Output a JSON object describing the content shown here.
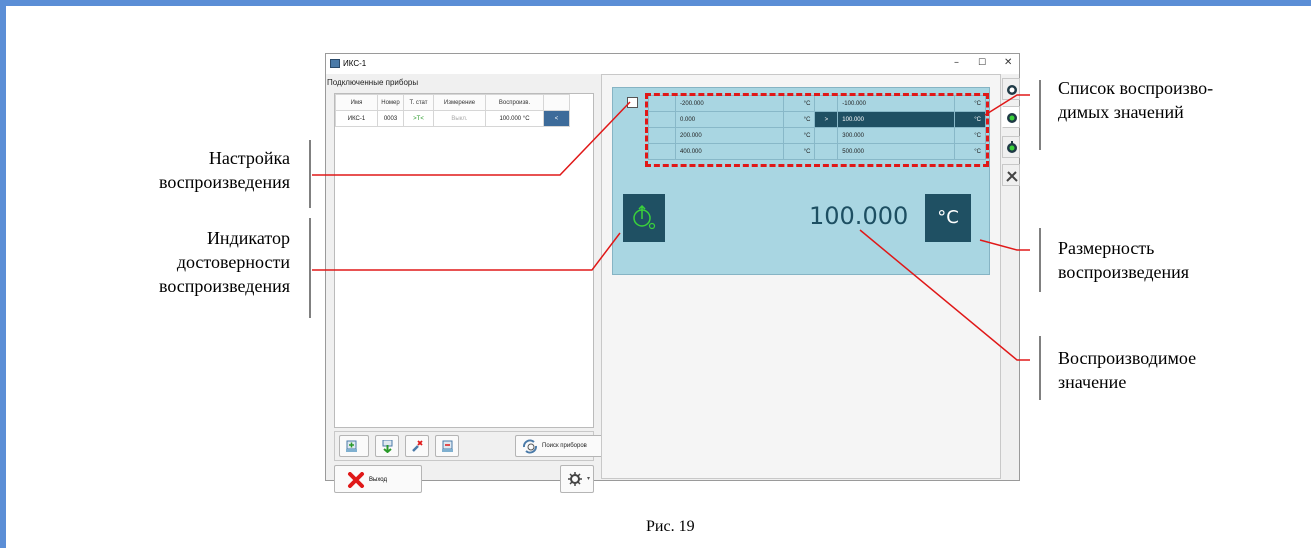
{
  "window": {
    "title": "ИКС-1",
    "minimize": "–",
    "maximize": "☐",
    "close": "✕"
  },
  "left_panel": {
    "section_title": "Подключенные приборы",
    "table": {
      "headers": [
        "Имя",
        "Номер",
        "Т. стат",
        "Измерение",
        "Воспроизв.",
        ""
      ],
      "rows": [
        [
          "ИКС-1",
          "0003",
          ">T<",
          "Выкл.",
          "100.000 °C",
          "<"
        ]
      ]
    },
    "search_button": "Поиск приборов",
    "exit_button": "Выход"
  },
  "values_table": {
    "rows": [
      {
        "from": "-200.000",
        "from_unit": "°C",
        "mid": "",
        "to": "-100.000",
        "to_unit": "°C",
        "active": false
      },
      {
        "from": "0.000",
        "from_unit": "°C",
        "mid": ">",
        "to": "100.000",
        "to_unit": "°C",
        "active": true
      },
      {
        "from": "200.000",
        "from_unit": "°C",
        "mid": "",
        "to": "300.000",
        "to_unit": "°C",
        "active": false
      },
      {
        "from": "400.000",
        "from_unit": "°C",
        "mid": "",
        "to": "500.000",
        "to_unit": "°C",
        "active": false
      }
    ]
  },
  "reproduction": {
    "value": "100.000",
    "unit": "°C"
  },
  "callouts": {
    "values_list": "Список воспроизво-\nдимых значений",
    "settings": "Настройка\nвоспроизведения",
    "indicator": "Индикатор\nдостоверности\nвоспроизведения",
    "dimension": "Размерность\nвоспроизведения",
    "value": "Воспроизводимое\nзначение"
  },
  "caption": "Рис. 19",
  "colors": {
    "frame": "#5b8ed6",
    "panel_blue": "#a9d6e2",
    "dark_teal": "#1f5063",
    "callout_line": "#e01818"
  }
}
